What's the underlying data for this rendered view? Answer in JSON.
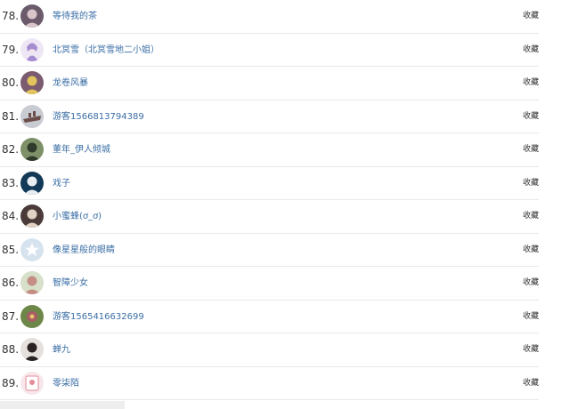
{
  "rows": [
    {
      "rank": "78.",
      "name": "等待我的茶",
      "action": "收藏",
      "avatar": {
        "bg": "#6b5a6a",
        "fg": "#d9c4c9",
        "icon": "portrait-icon"
      }
    },
    {
      "rank": "79.",
      "name": "北冥雪（北冥雪地二小姐）",
      "action": "收藏",
      "avatar": {
        "bg": "#efe6f5",
        "fg": "#a58bd0",
        "icon": "anime-girl-icon"
      }
    },
    {
      "rank": "80.",
      "name": "龙卷风暴",
      "action": "收藏",
      "avatar": {
        "bg": "#7a5b6f",
        "fg": "#e2c35d",
        "icon": "portrait-icon"
      }
    },
    {
      "rank": "81.",
      "name": "游客1566813794389",
      "action": "收藏",
      "avatar": {
        "bg": "#c9cbd2",
        "fg": "#6b4e4a",
        "icon": "ship-icon"
      }
    },
    {
      "rank": "82.",
      "name": "董年_伊人倾城",
      "action": "收藏",
      "avatar": {
        "bg": "#7d9067",
        "fg": "#2f3a2a",
        "icon": "portrait-icon"
      }
    },
    {
      "rank": "83.",
      "name": "戏子",
      "action": "收藏",
      "avatar": {
        "bg": "#123a58",
        "fg": "#e8eef2",
        "icon": "portrait-icon"
      }
    },
    {
      "rank": "84.",
      "name": "小蜜蜂(ơ_ơ)",
      "action": "收藏",
      "avatar": {
        "bg": "#4a3b38",
        "fg": "#e2d2c6",
        "icon": "portrait-icon"
      }
    },
    {
      "rank": "85.",
      "name": "像星星般的眼睛",
      "action": "收藏",
      "avatar": {
        "bg": "#d6e2ee",
        "fg": "#ffffff",
        "icon": "star-icon"
      }
    },
    {
      "rank": "86.",
      "name": "智障少女",
      "action": "收藏",
      "avatar": {
        "bg": "#d7e0c8",
        "fg": "#c48e86",
        "icon": "portrait-icon"
      }
    },
    {
      "rank": "87.",
      "name": "游客1565416632699",
      "action": "收藏",
      "avatar": {
        "bg": "#6d8749",
        "fg": "#a95b66",
        "icon": "flower-icon"
      }
    },
    {
      "rank": "88.",
      "name": "蝉九",
      "action": "收藏",
      "avatar": {
        "bg": "#e6e0dd",
        "fg": "#2a2222",
        "icon": "portrait-icon"
      }
    },
    {
      "rank": "89.",
      "name": "零柒陌",
      "action": "收藏",
      "avatar": {
        "bg": "#f7e7ea",
        "fg": "#e58b9a",
        "icon": "cute-card-icon"
      }
    }
  ]
}
